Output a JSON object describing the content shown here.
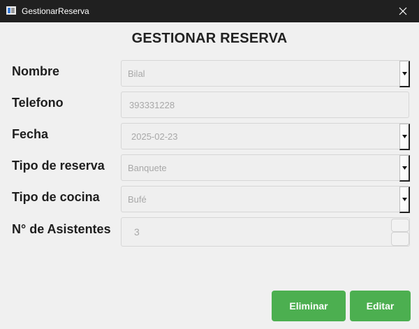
{
  "window": {
    "title": "GestionarReserva",
    "icon": "app-window-icon",
    "close_icon": "close-icon"
  },
  "form": {
    "heading": "GESTIONAR RESERVA",
    "fields": {
      "nombre": {
        "label": "Nombre",
        "value": "Bilal"
      },
      "telefono": {
        "label": "Telefono",
        "value": "393331228"
      },
      "fecha": {
        "label": "Fecha",
        "value": "2025-02-23"
      },
      "tipo_reserva": {
        "label": "Tipo de reserva",
        "value": "Banquete"
      },
      "tipo_cocina": {
        "label": "Tipo de cocina",
        "value": "Bufé"
      },
      "asistentes": {
        "label": "N° de Asistentes",
        "value": "3"
      }
    }
  },
  "actions": {
    "eliminar": "Eliminar",
    "editar": "Editar"
  },
  "colors": {
    "titlebar": "#202020",
    "background": "#f0f0f0",
    "button": "#4caf50",
    "disabled_text": "#a8a8a8"
  }
}
